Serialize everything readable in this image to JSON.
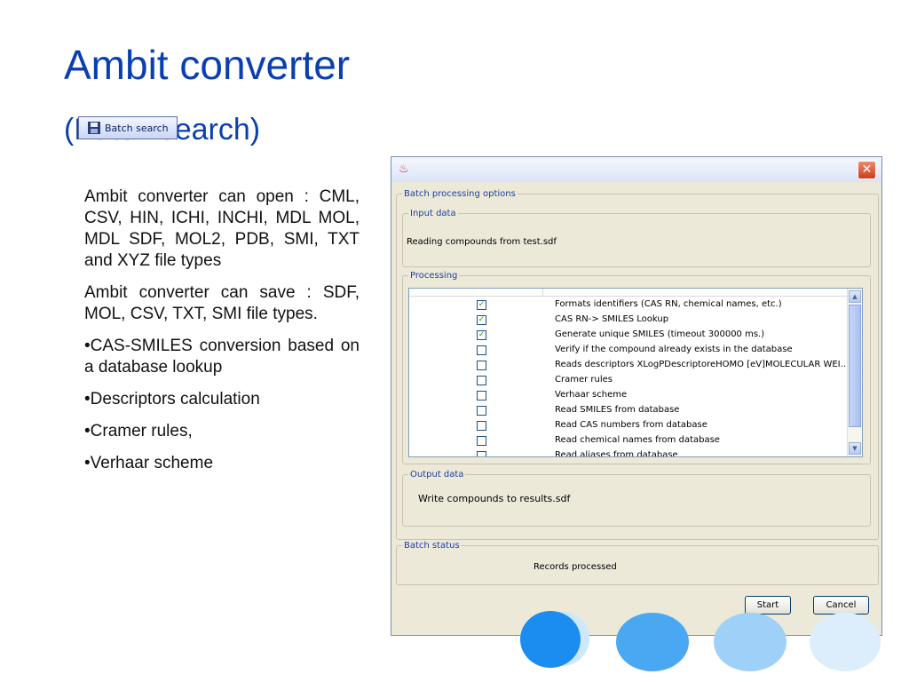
{
  "slide": {
    "title": "Ambit converter",
    "subtitle": "(Batch search)",
    "batch_button_label": "Batch search",
    "paragraphs": [
      "Ambit converter can open : CML, CSV, HIN, ICHI, INCHI, MDL MOL, MDL SDF, MOL2, PDB, SMI, TXT and XYZ file types",
      "Ambit converter can save : SDF, MOL, CSV, TXT, SMI file types.",
      "•CAS-SMILES conversion based on a database lookup",
      "•Descriptors calculation",
      "•Cramer rules,",
      "•Verhaar scheme"
    ]
  },
  "dialog": {
    "close_glyph": "✕",
    "batch_options_label": "Batch processing options",
    "input_legend": "Input data",
    "input_text": "Reading compounds from test.sdf",
    "processing_legend": "Processing",
    "processing_items": [
      {
        "label": "Formats identifiers (CAS RN, chemical names, etc.)",
        "checked": true
      },
      {
        "label": "CAS RN-> SMILES Lookup",
        "checked": true
      },
      {
        "label": "Generate unique SMILES (timeout 300000 ms.)",
        "checked": true
      },
      {
        "label": "Verify if the compound already exists in the database",
        "checked": false
      },
      {
        "label": "Reads descriptors XLogPDescriptoreHOMO [eV]MOLECULAR WEI…",
        "checked": false
      },
      {
        "label": "Cramer rules",
        "checked": false
      },
      {
        "label": "Verhaar scheme",
        "checked": false
      },
      {
        "label": "Read SMILES from database",
        "checked": false
      },
      {
        "label": "Read CAS numbers from database",
        "checked": false
      },
      {
        "label": "Read chemical names from database",
        "checked": false
      },
      {
        "label": "Read aliases from database",
        "checked": false
      }
    ],
    "output_legend": "Output data",
    "output_text": "Write compounds to results.sdf",
    "status_legend": "Batch status",
    "status_text": "Records processed",
    "start_label": "Start",
    "cancel_label": "Cancel"
  },
  "colors": {
    "title_blue": "#0a3fb0",
    "legend_blue": "#1c3fa3",
    "dialog_bg": "#ece9d8",
    "circle_dark": "#1c8df0",
    "circle_light": "#cfe7fb"
  }
}
